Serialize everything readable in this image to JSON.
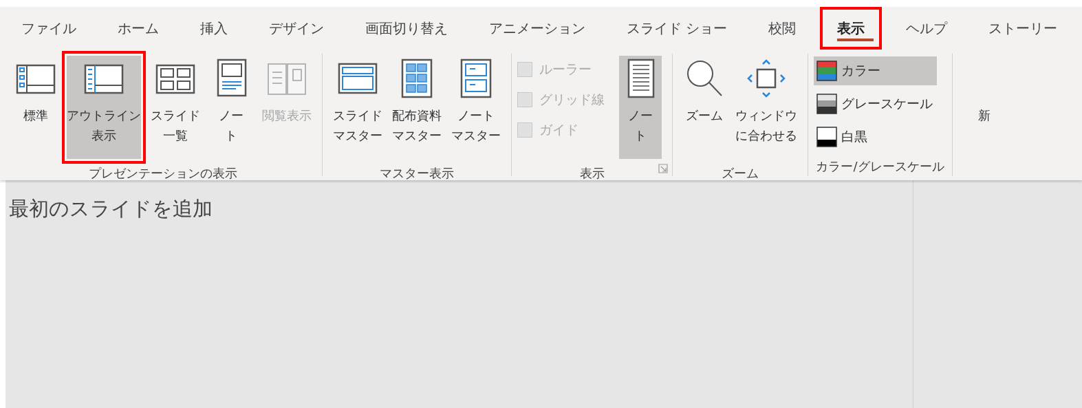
{
  "tabs": [
    {
      "label": "ファイル",
      "selected": false,
      "highlighted": false
    },
    {
      "label": "ホーム",
      "selected": false,
      "highlighted": false
    },
    {
      "label": "挿入",
      "selected": false,
      "highlighted": false
    },
    {
      "label": "デザイン",
      "selected": false,
      "highlighted": false
    },
    {
      "label": "画面切り替え",
      "selected": false,
      "highlighted": false
    },
    {
      "label": "アニメーション",
      "selected": false,
      "highlighted": false
    },
    {
      "label": "スライド ショー",
      "selected": false,
      "highlighted": false
    },
    {
      "label": "校閲",
      "selected": false,
      "highlighted": false
    },
    {
      "label": "表示",
      "selected": true,
      "highlighted": true
    },
    {
      "label": "ヘルプ",
      "selected": false,
      "highlighted": false
    },
    {
      "label": "ストーリー",
      "selected": false,
      "highlighted": false
    }
  ],
  "ribbon": {
    "groups": [
      {
        "label": "プレゼンテーションの表示",
        "items": [
          {
            "kind": "large",
            "lines": [
              "標準"
            ],
            "selected": false,
            "disabled": false,
            "highlighted": false
          },
          {
            "kind": "large",
            "lines": [
              "アウトライン",
              "表示"
            ],
            "selected": true,
            "disabled": false,
            "highlighted": true
          },
          {
            "kind": "large",
            "lines": [
              "スライド",
              "一覧"
            ],
            "selected": false,
            "disabled": false,
            "highlighted": false
          },
          {
            "kind": "large",
            "lines": [
              "ノー",
              "ト"
            ],
            "selected": false,
            "disabled": false,
            "highlighted": false
          },
          {
            "kind": "large",
            "lines": [
              "閲覧表示"
            ],
            "selected": false,
            "disabled": true,
            "highlighted": false
          }
        ]
      },
      {
        "label": "マスター表示",
        "items": [
          {
            "kind": "large",
            "lines": [
              "スライド",
              "マスター"
            ],
            "selected": false,
            "disabled": false,
            "highlighted": false
          },
          {
            "kind": "large",
            "lines": [
              "配布資料",
              "マスター"
            ],
            "selected": false,
            "disabled": false,
            "highlighted": false
          },
          {
            "kind": "large",
            "lines": [
              "ノート",
              "マスター"
            ],
            "selected": false,
            "disabled": false,
            "highlighted": false
          }
        ]
      },
      {
        "label": "表示",
        "launcher": true,
        "items": [
          {
            "kind": "checkbox",
            "label": "ルーラー",
            "checked": false,
            "disabled": true
          },
          {
            "kind": "checkbox",
            "label": "グリッド線",
            "checked": false,
            "disabled": true
          },
          {
            "kind": "checkbox",
            "label": "ガイド",
            "checked": false,
            "disabled": true
          },
          {
            "kind": "large",
            "lines": [
              "ノー",
              "ト"
            ],
            "selected": true,
            "disabled": false,
            "highlighted": false
          }
        ]
      },
      {
        "label": "ズーム",
        "items": [
          {
            "kind": "large",
            "lines": [
              "ズーム"
            ],
            "selected": false,
            "disabled": false,
            "highlighted": false
          },
          {
            "kind": "large",
            "lines": [
              "ウィンドウ",
              "に合わせる"
            ],
            "selected": false,
            "disabled": false,
            "highlighted": false
          }
        ]
      },
      {
        "label": "カラー/グレースケール",
        "items": [
          {
            "kind": "mode",
            "label": "カラー",
            "selected": true
          },
          {
            "kind": "mode",
            "label": "グレースケール",
            "selected": false
          },
          {
            "kind": "mode",
            "label": "白黒",
            "selected": false
          }
        ]
      },
      {
        "items": [
          {
            "kind": "large",
            "lines": [
              "新"
            ],
            "selected": false,
            "disabled": false,
            "highlighted": false
          }
        ]
      }
    ]
  },
  "outline_pane": {
    "prompt": "最初のスライドを追加"
  }
}
